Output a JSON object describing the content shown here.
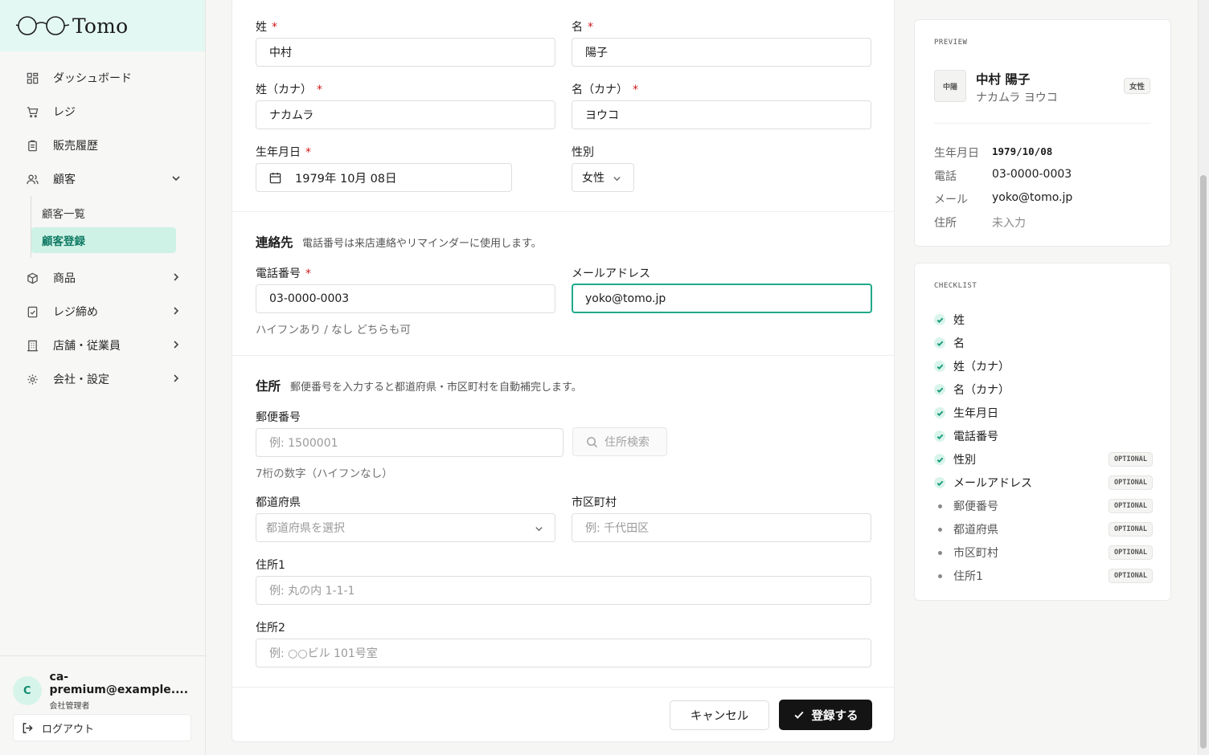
{
  "brand": {
    "name": "Tomo",
    "icon": "glasses-icon"
  },
  "sidebar": {
    "items": [
      {
        "label": "ダッシュボード",
        "icon": "dashboard-icon"
      },
      {
        "label": "レジ",
        "icon": "cart-icon"
      },
      {
        "label": "販売履歴",
        "icon": "clipboard-icon"
      },
      {
        "label": "顧客",
        "icon": "users-icon",
        "expanded": true
      },
      {
        "label": "商品",
        "icon": "box-icon"
      },
      {
        "label": "レジ締め",
        "icon": "register-close-icon"
      },
      {
        "label": "店舗・従業員",
        "icon": "building-icon"
      },
      {
        "label": "会社・設定",
        "icon": "gear-icon"
      }
    ],
    "sub_items": [
      {
        "label": "顧客一覧",
        "active": false
      },
      {
        "label": "顧客登録",
        "active": true
      }
    ],
    "user": {
      "initial": "C",
      "email": "ca-premium@example....",
      "role": "会社管理者"
    },
    "logout_label": "ログアウト"
  },
  "form": {
    "last_name": {
      "label": "姓",
      "value": "中村"
    },
    "first_name": {
      "label": "名",
      "value": "陽子"
    },
    "last_name_kana": {
      "label": "姓（カナ）",
      "value": "ナカムラ"
    },
    "first_name_kana": {
      "label": "名（カナ）",
      "value": "ヨウコ"
    },
    "birthdate": {
      "label": "生年月日",
      "value": "1979年 10月 08日"
    },
    "gender": {
      "label": "性別",
      "value": "女性"
    },
    "required_mark": "*",
    "contact": {
      "title": "連絡先",
      "desc": "電話番号は来店連絡やリマインダーに使用します。",
      "phone": {
        "label": "電話番号",
        "value": "03-0000-0003",
        "help": "ハイフンあり / なし どちらも可"
      },
      "email": {
        "label": "メールアドレス",
        "value": "yoko@tomo.jp"
      }
    },
    "address": {
      "title": "住所",
      "desc": "郵便番号を入力すると都道府県・市区町村を自動補完します。",
      "postal": {
        "label": "郵便番号",
        "placeholder": "例: 1500001",
        "help": "7桁の数字（ハイフンなし）"
      },
      "search_button": "住所検索",
      "prefecture": {
        "label": "都道府県",
        "placeholder": "都道府県を選択"
      },
      "city": {
        "label": "市区町村",
        "placeholder": "例: 千代田区"
      },
      "address1": {
        "label": "住所1",
        "placeholder": "例: 丸の内 1-1-1"
      },
      "address2": {
        "label": "住所2",
        "placeholder": "例: ○○ビル 101号室"
      }
    },
    "cancel_label": "キャンセル",
    "submit_label": "登録する"
  },
  "preview": {
    "heading": "PREVIEW",
    "avatar_text": "中陽",
    "name": "中村 陽子",
    "kana": "ナカムラ ヨウコ",
    "badge": "女性",
    "rows": [
      {
        "key": "生年月日",
        "value": "1979/10/08"
      },
      {
        "key": "電話",
        "value": "03-0000-0003"
      },
      {
        "key": "メール",
        "value": "yoko@tomo.jp"
      },
      {
        "key": "住所",
        "value": "未入力"
      }
    ]
  },
  "checklist": {
    "heading": "CHECKLIST",
    "optional_label": "OPTIONAL",
    "items": [
      {
        "label": "姓",
        "done": true,
        "optional": false
      },
      {
        "label": "名",
        "done": true,
        "optional": false
      },
      {
        "label": "姓（カナ）",
        "done": true,
        "optional": false
      },
      {
        "label": "名（カナ）",
        "done": true,
        "optional": false
      },
      {
        "label": "生年月日",
        "done": true,
        "optional": false
      },
      {
        "label": "電話番号",
        "done": true,
        "optional": false
      },
      {
        "label": "性別",
        "done": true,
        "optional": true
      },
      {
        "label": "メールアドレス",
        "done": true,
        "optional": true
      },
      {
        "label": "郵便番号",
        "done": false,
        "optional": true
      },
      {
        "label": "都道府県",
        "done": false,
        "optional": true
      },
      {
        "label": "市区町村",
        "done": false,
        "optional": true
      },
      {
        "label": "住所1",
        "done": false,
        "optional": true
      }
    ]
  },
  "colors": {
    "accent": "#1fa98a",
    "brand_bg": "#e3f8f2",
    "active_bg": "#cff2e6",
    "required": "#d21c1c"
  }
}
